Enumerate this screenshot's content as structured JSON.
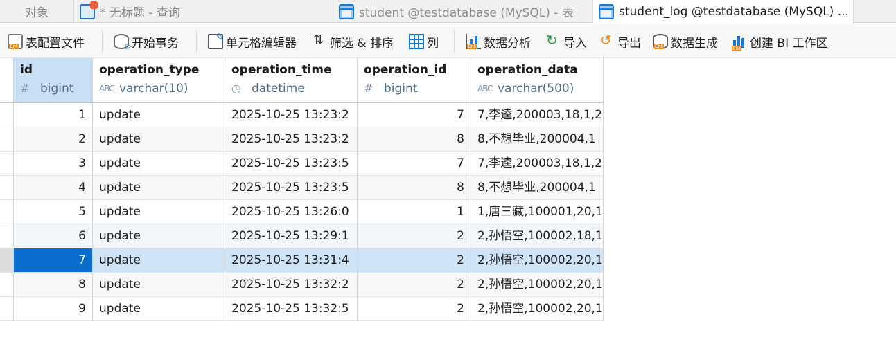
{
  "tabs": [
    {
      "label": "对象",
      "icon": "none",
      "active": false
    },
    {
      "label": "* 无标题 - 查询",
      "icon": "query-icon",
      "active": false
    },
    {
      "label": "student @testdatabase (MySQL) - 表",
      "icon": "table-icon",
      "active": false
    },
    {
      "label": "student_log @testdatabase (MySQL) ...",
      "icon": "table-icon",
      "active": true
    }
  ],
  "toolbar": {
    "config": "表配置文件",
    "transaction": "开始事务",
    "cell_editor": "单元格编辑器",
    "filter_sort": "筛选 & 排序",
    "columns": "列",
    "analysis": "数据分析",
    "import": "导入",
    "export": "导出",
    "generate": "数据生成",
    "bi": "创建 BI 工作区"
  },
  "table": {
    "columns": [
      {
        "name": "id",
        "type": "bigint",
        "type_icon": "number-icon"
      },
      {
        "name": "operation_type",
        "type": "varchar(10)",
        "type_icon": "text-icon"
      },
      {
        "name": "operation_time",
        "type": "datetime",
        "type_icon": "clock-icon"
      },
      {
        "name": "operation_id",
        "type": "bigint",
        "type_icon": "number-icon"
      },
      {
        "name": "operation_data",
        "type": "varchar(500)",
        "type_icon": "text-icon"
      }
    ],
    "rows": [
      [
        "1",
        "update",
        "2025-10-25 13:23:2",
        "7",
        "7,李逵,200003,18,1,2"
      ],
      [
        "2",
        "update",
        "2025-10-25 13:23:2",
        "8",
        "8,不想毕业,200004,1"
      ],
      [
        "3",
        "update",
        "2025-10-25 13:23:5",
        "7",
        "7,李逵,200003,18,1,2"
      ],
      [
        "4",
        "update",
        "2025-10-25 13:23:5",
        "8",
        "8,不想毕业,200004,1"
      ],
      [
        "5",
        "update",
        "2025-10-25 13:26:0",
        "1",
        "1,唐三藏,100001,20,1"
      ],
      [
        "6",
        "update",
        "2025-10-25 13:29:1",
        "2",
        "2,孙悟空,100002,18,1"
      ],
      [
        "7",
        "update",
        "2025-10-25 13:31:4",
        "2",
        "2,孙悟空,100002,20,1"
      ],
      [
        "8",
        "update",
        "2025-10-25 13:32:2",
        "2",
        "2,孙悟空,100002,20,1"
      ],
      [
        "9",
        "update",
        "2025-10-25 13:32:5",
        "2",
        "2,孙悟空,100002,20,1"
      ]
    ],
    "selected_row": 6,
    "hover_row": 5
  },
  "colors": {
    "accent": "#0a6ed1",
    "selected_row_bg": "#cfe3f7",
    "header_selected_bg": "#c9dff3"
  }
}
